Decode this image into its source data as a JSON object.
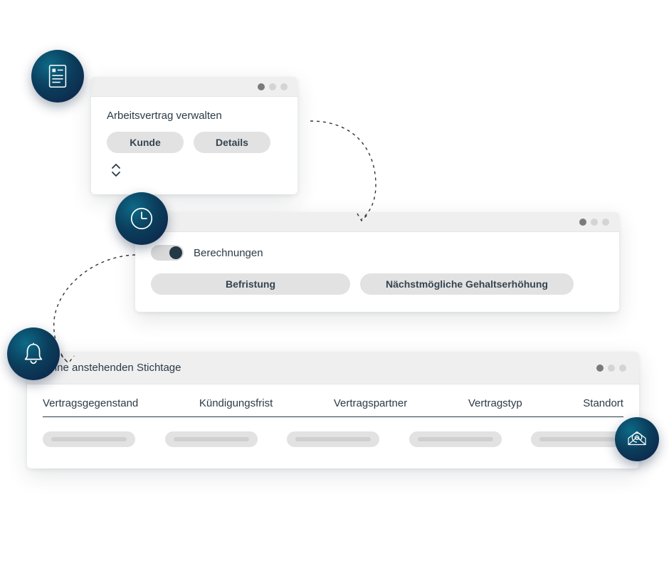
{
  "card1": {
    "title": "Arbeitsvertrag verwalten",
    "buttons": {
      "customer": "Kunde",
      "details": "Details"
    }
  },
  "card2": {
    "toggle_label": "Berechnungen",
    "buttons": {
      "term": "Befristung",
      "next_raise": "Nächstmögliche Gehaltserhöhung"
    }
  },
  "card3": {
    "title": "Meine anstehenden Stichtage",
    "columns": [
      "Vertragsgegenstand",
      "Kündigungsfrist",
      "Vertragspartner",
      "Vertragstyp",
      "Standort"
    ]
  },
  "icons": {
    "document": "document-icon",
    "clock": "clock-icon",
    "bell": "bell-icon",
    "mail": "mail-at-icon"
  }
}
